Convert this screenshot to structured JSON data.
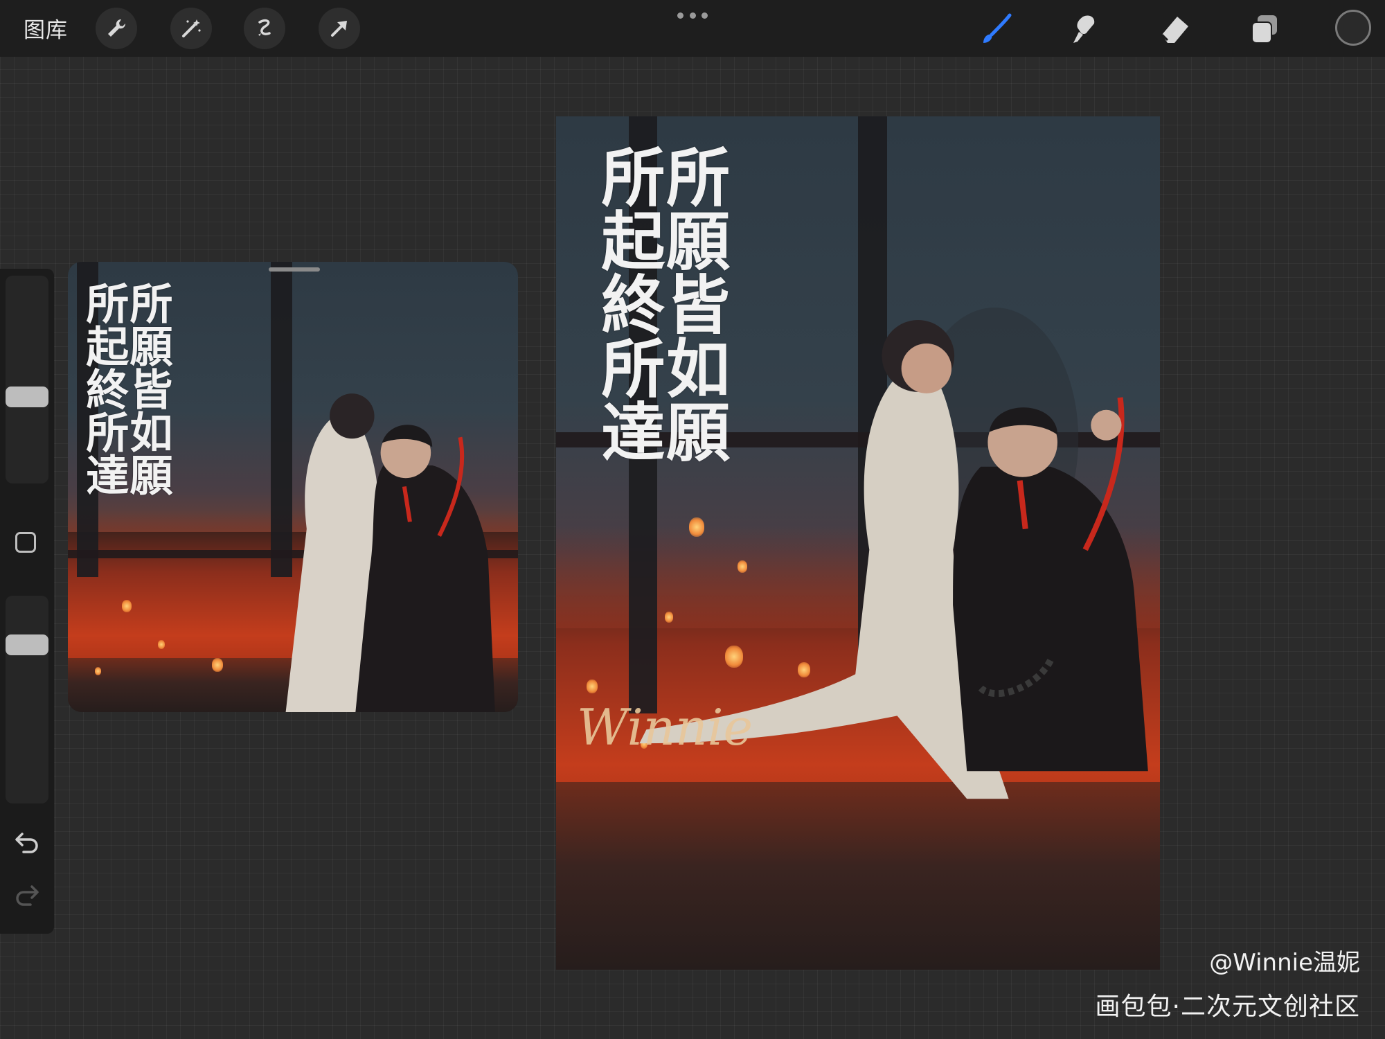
{
  "toolbar": {
    "gallery_label": "图库",
    "tools_left": [
      "wrench-icon",
      "magic-wand-icon",
      "selection-icon",
      "transform-arrow-icon"
    ],
    "tools_right": [
      "brush-icon",
      "smudge-icon",
      "eraser-icon",
      "layers-icon"
    ],
    "active_tool_color": "#2f7bff"
  },
  "sidebar": {
    "brush_size_level": 0.55,
    "opacity_level": 0.2
  },
  "artwork": {
    "calligraphy_lines": [
      "所願皆如願",
      "所起終所達"
    ],
    "signature": "Winnie"
  },
  "watermark": {
    "author": "@Winnie温妮",
    "site": "画包包·二次元文创社区"
  },
  "colors": {
    "toolbar_bg": "#1e1e1e",
    "canvas_bg": "#2b2b2b",
    "glow": "#c43d1c"
  }
}
